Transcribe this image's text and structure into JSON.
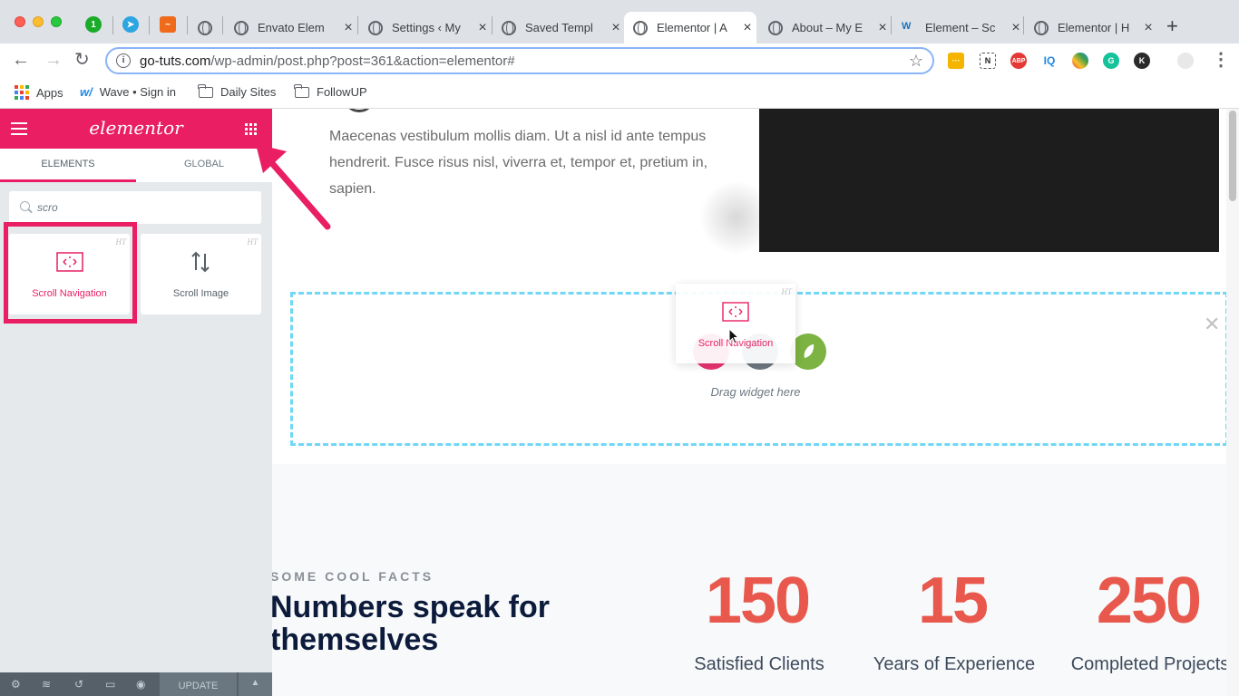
{
  "browser": {
    "tabs": [
      {
        "title": "Envato Elem"
      },
      {
        "title": "Settings ‹ My"
      },
      {
        "title": "Saved Templ"
      },
      {
        "title": "Elementor | A"
      },
      {
        "title": "About – My E"
      },
      {
        "title": "Element – Sc"
      },
      {
        "title": "Elementor | H"
      }
    ],
    "url_host": "go-tuts.com",
    "url_path": "/wp-admin/post.php?post=361&action=elementor#",
    "bookmarks": {
      "apps": "Apps",
      "wave": "Wave • Sign in",
      "daily": "Daily Sites",
      "followup": "FollowUP"
    }
  },
  "panel": {
    "logo": "elementor",
    "tabs": {
      "elements": "ELEMENTS",
      "global": "GLOBAL"
    },
    "search_value": "scro",
    "widgets": [
      {
        "label": "Scroll Navigation",
        "badge": "HT",
        "icon": "scroll-navigation-icon"
      },
      {
        "label": "Scroll Image",
        "badge": "HT",
        "icon": "scroll-image-icon"
      }
    ],
    "footer": {
      "update": "UPDATE"
    }
  },
  "preview": {
    "paragraph": "Maecenas vestibulum mollis diam. Ut a nisl id ante tempus hendrerit. Fusce risus nisl, viverra et, tempor et, pretium in, sapien.",
    "drop_hint": "Drag widget here",
    "dragging_widget": {
      "label": "Scroll Navigation",
      "badge": "HT"
    },
    "facts": {
      "kicker": "SOME COOL FACTS",
      "heading_line1": "Numbers speak for",
      "heading_line2": "themselves",
      "stats": [
        {
          "value": "150",
          "label": "Satisfied Clients"
        },
        {
          "value": "15",
          "label": "Years of Experience"
        },
        {
          "value": "250",
          "label": "Completed Projects"
        }
      ]
    }
  },
  "colors": {
    "elementor_pink": "#e91e63",
    "stat_red": "#e8584d",
    "drop_border": "#71d7f7",
    "heading_navy": "#0c1b3b"
  }
}
